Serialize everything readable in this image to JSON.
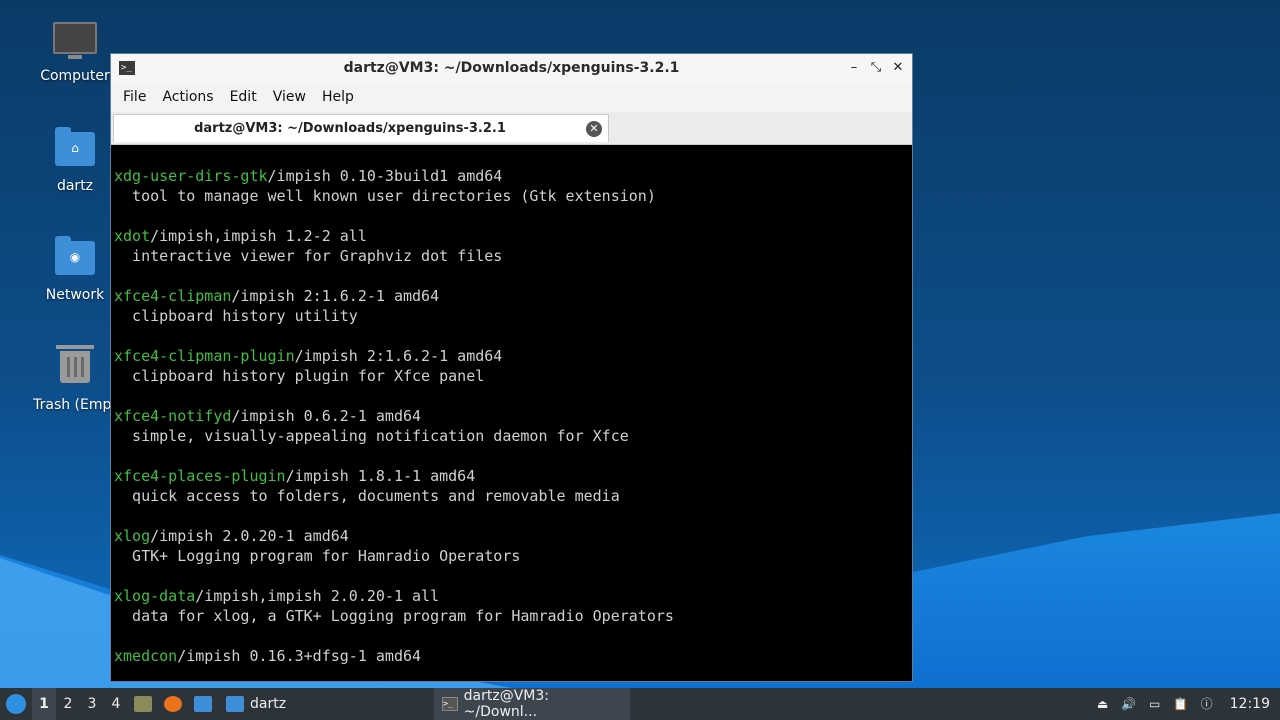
{
  "desktop": {
    "icons": [
      {
        "label": "Computer"
      },
      {
        "label": "dartz"
      },
      {
        "label": "Network"
      },
      {
        "label": "Trash (Empt"
      }
    ]
  },
  "window": {
    "title": "dartz@VM3: ~/Downloads/xpenguins-3.2.1",
    "menu": [
      "File",
      "Actions",
      "Edit",
      "View",
      "Help"
    ],
    "tab_title": "dartz@VM3: ~/Downloads/xpenguins-3.2.1",
    "controls": {
      "minimize": "–",
      "maximize": "⤡",
      "close": "✕"
    }
  },
  "terminal": {
    "lines": [
      {
        "pkg": "xdg-user-dirs-gtk",
        "rest": "/impish 0.10-3build1 amd64"
      },
      {
        "pkg": "",
        "rest": "  tool to manage well known user directories (Gtk extension)"
      },
      {
        "pkg": "",
        "rest": ""
      },
      {
        "pkg": "xdot",
        "rest": "/impish,impish 1.2-2 all"
      },
      {
        "pkg": "",
        "rest": "  interactive viewer for Graphviz dot files"
      },
      {
        "pkg": "",
        "rest": ""
      },
      {
        "pkg": "xfce4-clipman",
        "rest": "/impish 2:1.6.2-1 amd64"
      },
      {
        "pkg": "",
        "rest": "  clipboard history utility"
      },
      {
        "pkg": "",
        "rest": ""
      },
      {
        "pkg": "xfce4-clipman-plugin",
        "rest": "/impish 2:1.6.2-1 amd64"
      },
      {
        "pkg": "",
        "rest": "  clipboard history plugin for Xfce panel"
      },
      {
        "pkg": "",
        "rest": ""
      },
      {
        "pkg": "xfce4-notifyd",
        "rest": "/impish 0.6.2-1 amd64"
      },
      {
        "pkg": "",
        "rest": "  simple, visually-appealing notification daemon for Xfce"
      },
      {
        "pkg": "",
        "rest": ""
      },
      {
        "pkg": "xfce4-places-plugin",
        "rest": "/impish 1.8.1-1 amd64"
      },
      {
        "pkg": "",
        "rest": "  quick access to folders, documents and removable media"
      },
      {
        "pkg": "",
        "rest": ""
      },
      {
        "pkg": "xlog",
        "rest": "/impish 2.0.20-1 amd64"
      },
      {
        "pkg": "",
        "rest": "  GTK+ Logging program for Hamradio Operators"
      },
      {
        "pkg": "",
        "rest": ""
      },
      {
        "pkg": "xlog-data",
        "rest": "/impish,impish 2.0.20-1 all"
      },
      {
        "pkg": "",
        "rest": "  data for xlog, a GTK+ Logging program for Hamradio Operators"
      },
      {
        "pkg": "",
        "rest": ""
      },
      {
        "pkg": "xmedcon",
        "rest": "/impish 0.16.3+dfsg-1 amd64"
      }
    ]
  },
  "taskbar": {
    "workspaces": [
      "1",
      "2",
      "3",
      "4"
    ],
    "active_workspace": "1",
    "tasks": [
      {
        "label": "dartz",
        "icon": "folder-icon"
      },
      {
        "label": "dartz@VM3: ~/Downl...",
        "icon": "terminal-icon"
      }
    ],
    "clock": "12:19"
  },
  "colors": {
    "package_name": "#3fbf3f",
    "terminal_bg": "#000000",
    "terminal_fg": "#d0d0d0"
  }
}
